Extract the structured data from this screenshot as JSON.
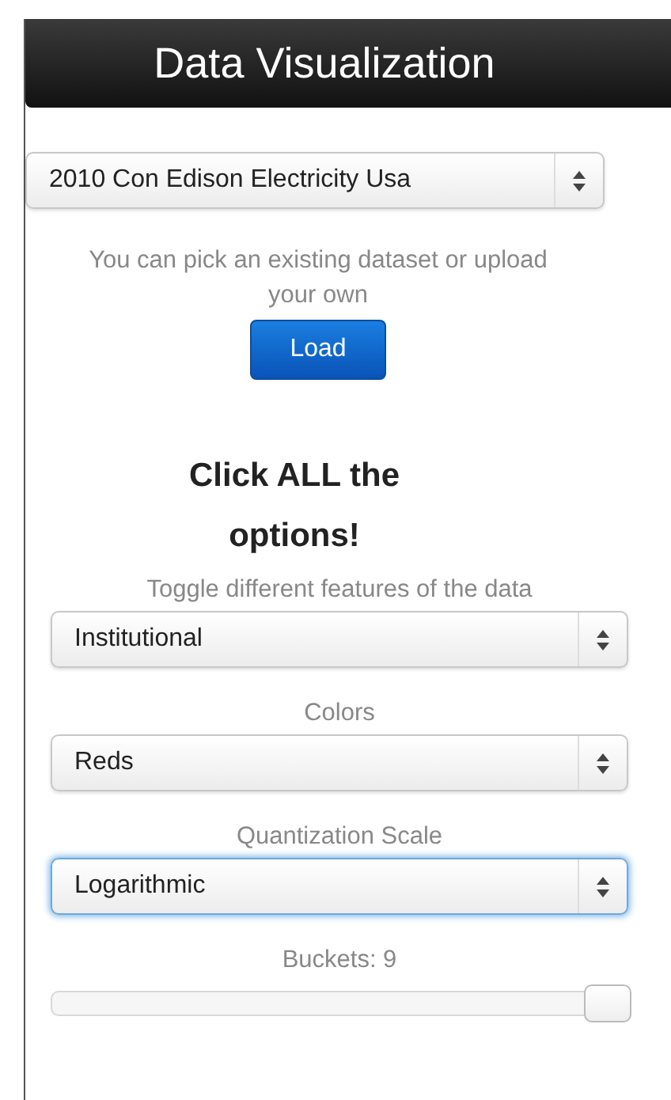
{
  "header": {
    "title": "Data Visualization"
  },
  "dataset": {
    "value": "2010 Con Edison Electricity Usa",
    "hint": "You can pick an existing dataset or upload your own",
    "button": "Load"
  },
  "heading": "Click ALL the options!",
  "controls": [
    {
      "label": "Toggle different features of the data",
      "value": "Institutional",
      "focused": false
    },
    {
      "label": "Colors",
      "value": "Reds",
      "focused": false
    },
    {
      "label": "Quantization Scale",
      "value": "Logarithmic",
      "focused": true
    }
  ],
  "buckets": {
    "label": "Buckets: 9",
    "level": 1
  }
}
